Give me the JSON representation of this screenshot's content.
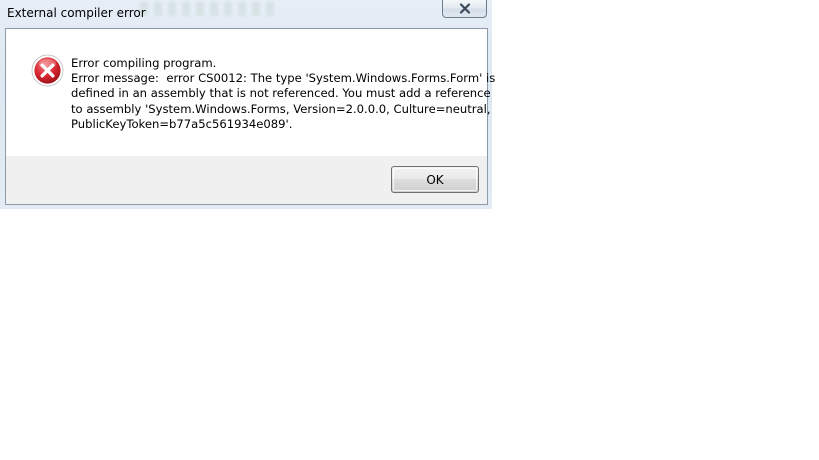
{
  "window": {
    "title": "External compiler error",
    "close_icon": "close-icon"
  },
  "message": {
    "icon": "error-icon",
    "lines": [
      "Error compiling program.",
      "Error message:  error CS0012: The type 'System.Windows.Forms.Form' is",
      "defined in an assembly that is not referenced. You must add a reference",
      "to assembly 'System.Windows.Forms, Version=2.0.0.0, Culture=neutral,",
      "PublicKeyToken=b77a5c561934e089'."
    ]
  },
  "buttons": {
    "ok_label": "OK"
  },
  "colors": {
    "error_red": "#d4202a",
    "frame": "#dde8f2",
    "footer": "#f0f0f0"
  }
}
